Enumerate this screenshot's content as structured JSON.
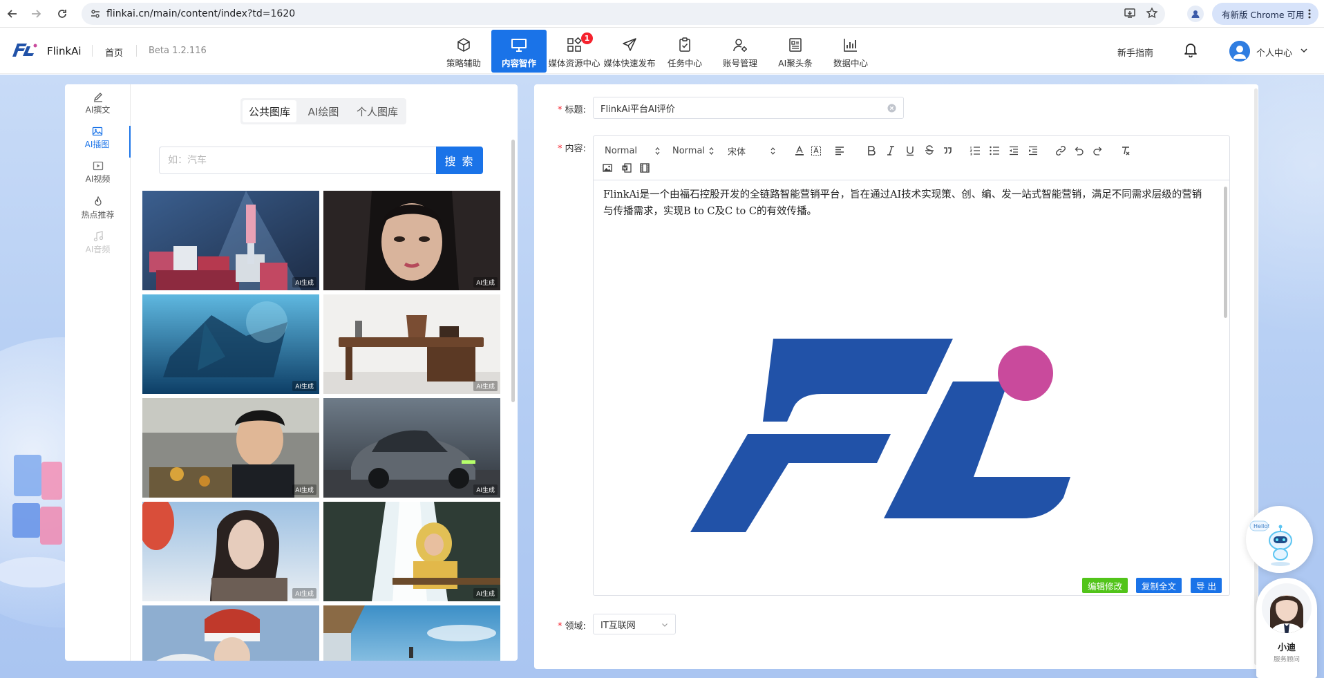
{
  "browser": {
    "url": "flinkai.cn/main/content/index?td=1620",
    "update_label": "有新版 Chrome 可用"
  },
  "header": {
    "brand": "FlinkAi",
    "home": "首页",
    "version": "Beta 1.2.116",
    "nav": [
      {
        "label": "策略辅助",
        "icon": "cube-icon"
      },
      {
        "label": "内容智作",
        "icon": "monitor-icon",
        "active": true
      },
      {
        "label": "媒体资源中心",
        "icon": "grid-icon",
        "badge": "1"
      },
      {
        "label": "媒体快速发布",
        "icon": "send-icon"
      },
      {
        "label": "任务中心",
        "icon": "clipboard-icon"
      },
      {
        "label": "账号管理",
        "icon": "user-gear-icon"
      },
      {
        "label": "AI聚头条",
        "icon": "news-icon"
      },
      {
        "label": "数据中心",
        "icon": "chart-icon"
      }
    ],
    "guide": "新手指南",
    "user_center": "个人中心"
  },
  "left": {
    "side_tabs": [
      {
        "label": "AI撰文",
        "icon": "pen-icon"
      },
      {
        "label": "AI插图",
        "icon": "image-icon",
        "active": true
      },
      {
        "label": "AI视频",
        "icon": "video-icon"
      },
      {
        "label": "热点推荐",
        "icon": "fire-icon"
      },
      {
        "label": "AI音频",
        "icon": "music-icon",
        "disabled": true
      }
    ],
    "library_tabs": [
      "公共图库",
      "AI绘图",
      "个人图库"
    ],
    "search_placeholder": "如：汽车",
    "search_button": "搜 索",
    "gallery_tag": "AI生成"
  },
  "right": {
    "title_label": "标题:",
    "title_value": "FlinkAi平台AI评价",
    "content_label": "内容:",
    "toolbar": {
      "header_select": "Normal",
      "size_select": "Normal",
      "font_select": "宋体"
    },
    "content_text": "FlinkAi是一个由福石控股开发的全链路智能营销平台，旨在通过AI技术实现策、创、编、发一站式智能营销，满足不同需求层级的营销与传播需求，实现B to C及C to C的有效传播。",
    "buttons": {
      "edit": "编辑修改",
      "copy": "复制全文",
      "export": "导 出"
    },
    "domain_label": "领域:",
    "domain_value": "IT互联网",
    "colors": {
      "edit": "#52c41a",
      "primary": "#1a73e8",
      "logo_blue": "#2152a8",
      "logo_pink": "#c94a9c"
    }
  },
  "assistant": {
    "name": "小迪",
    "role": "服务顾问",
    "bubble_text": "Hello!"
  }
}
